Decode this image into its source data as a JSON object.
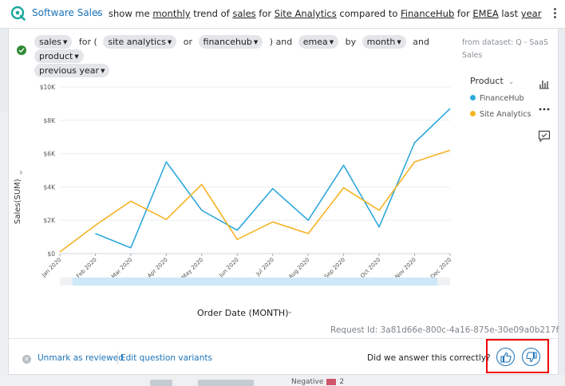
{
  "topbar": {
    "topic": "Software Sales",
    "query_parts": [
      {
        "text": "show me ",
        "u": false
      },
      {
        "text": "monthly",
        "u": true
      },
      {
        "text": " trend of ",
        "u": false
      },
      {
        "text": "sales",
        "u": true
      },
      {
        "text": " for ",
        "u": false
      },
      {
        "text": "Site Analytics",
        "u": true
      },
      {
        "text": " compared to ",
        "u": false
      },
      {
        "text": "FinanceHub",
        "u": true
      },
      {
        "text": " for ",
        "u": false
      },
      {
        "text": "EMEA",
        "u": true
      },
      {
        "text": " last ",
        "u": false
      },
      {
        "text": "year",
        "u": true
      }
    ]
  },
  "filters": {
    "pill_sales": "sales",
    "conn_for": "for (",
    "pill_site": "site analytics",
    "conn_or": "or",
    "pill_finance": "financehub",
    "conn_and": ") and",
    "pill_emea": "emea",
    "conn_by": "by",
    "pill_month": "month",
    "conn_and2": "and",
    "pill_product": "product",
    "pill_prev": "previous year"
  },
  "dataset": "from dataset: Q - SaaS Sales",
  "legend": {
    "title": "Product",
    "items": [
      {
        "label": "FinanceHub",
        "color": "#2ea8dc"
      },
      {
        "label": "Site Analytics",
        "color": "#f5b324"
      }
    ]
  },
  "chart_data": {
    "type": "line",
    "xlabel": "Order Date (MONTH)",
    "ylabel": "Sales(SUM)",
    "ylim": [
      0,
      10000
    ],
    "yticks": [
      "$0",
      "$2K",
      "$4K",
      "$6K",
      "$8K",
      "$10K"
    ],
    "categories": [
      "Jan 2020",
      "Feb 2020",
      "Mar 2020",
      "Apr 2020",
      "May 2020",
      "Jun 2020",
      "Jul 2020",
      "Aug 2020",
      "Sep 2020",
      "Oct 2020",
      "Nov 2020",
      "Dec 2020"
    ],
    "series": [
      {
        "name": "FinanceHub",
        "color": "#2ea8dc",
        "values": [
          null,
          1200,
          350,
          5500,
          2600,
          1400,
          3900,
          2000,
          5300,
          1600,
          6650,
          8700
        ]
      },
      {
        "name": "Site Analytics",
        "color": "#f5b324",
        "values": [
          100,
          1700,
          3150,
          2050,
          4150,
          850,
          1900,
          1200,
          3950,
          2600,
          5500,
          6200
        ]
      }
    ],
    "grid": true,
    "legend_position": "right"
  },
  "footer": {
    "request_id": "Request Id: 3a81d66e-800c-4a16-875e-30e09a0b217f",
    "unmark": "Unmark as reviewed",
    "edit": "Edit question variants",
    "question": "Did we answer this correctly?"
  },
  "background": {
    "negative_label": "Negative",
    "negative_value": "2"
  }
}
